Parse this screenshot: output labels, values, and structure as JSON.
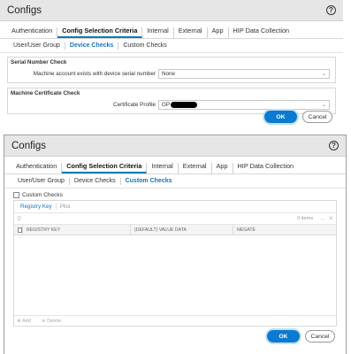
{
  "dialog1": {
    "title": "Configs",
    "tabs": [
      "Authentication",
      "Config Selection Criteria",
      "Internal",
      "External",
      "App",
      "HIP Data Collection"
    ],
    "active_tab": 1,
    "subtabs": [
      "User/User Group",
      "Device Checks",
      "Custom Checks"
    ],
    "active_subtab": 1,
    "serial_group": {
      "legend": "Serial Number Check",
      "label": "Machine account exists with device serial number",
      "value": "None"
    },
    "cert_group": {
      "legend": "Machine Certificate Check",
      "label": "Certificate Profile",
      "value": "GP"
    },
    "ok_label": "OK",
    "cancel_label": "Cancel"
  },
  "dialog2": {
    "title": "Configs",
    "tabs": [
      "Authentication",
      "Config Selection Criteria",
      "Internal",
      "External",
      "App",
      "HIP Data Collection"
    ],
    "active_tab": 1,
    "subtabs": [
      "User/User Group",
      "Device Checks",
      "Custom Checks"
    ],
    "active_subtab": 2,
    "custom_checks_label": "Custom Checks",
    "inner_tabs": [
      "Registry Key",
      "Plist"
    ],
    "active_inner_tab": 0,
    "item_count": "0 items",
    "columns": [
      "REGISTRY KEY",
      "(DEFAULT) VALUE DATA",
      "NEGATE"
    ],
    "add_label": "Add",
    "delete_label": "Delete",
    "ok_label": "OK",
    "cancel_label": "Cancel"
  },
  "colors": {
    "accent": "#0a7bd0",
    "active_link": "#1476bf",
    "titlebar": "#e6e6e6"
  }
}
